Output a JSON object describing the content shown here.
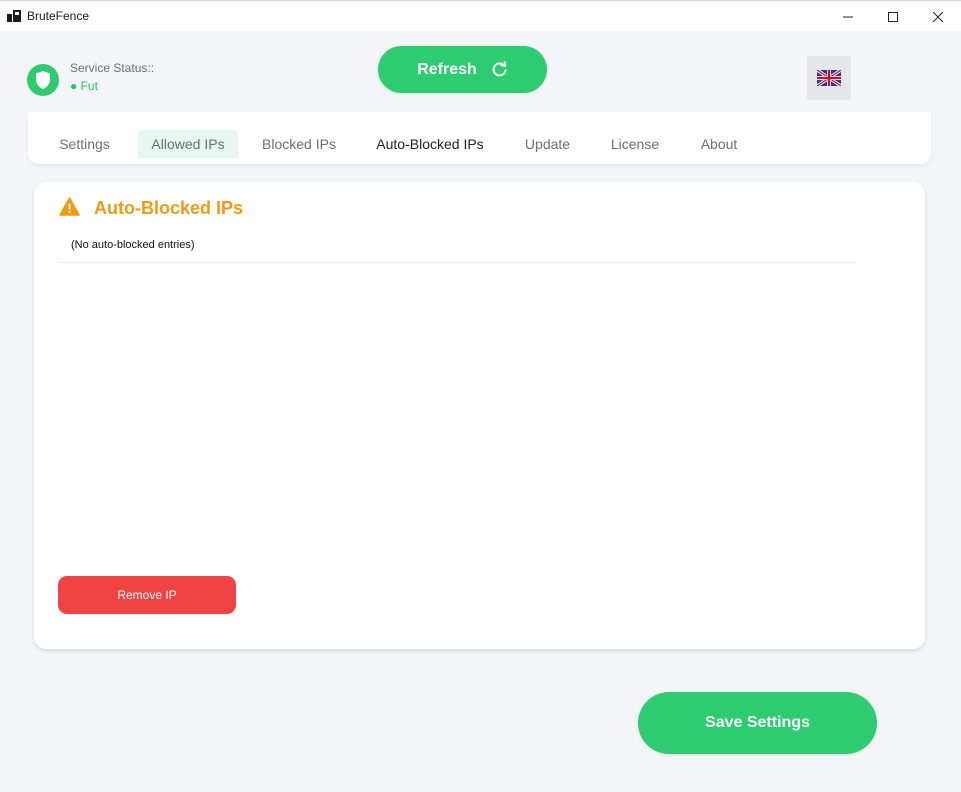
{
  "window": {
    "title": "BruteFence"
  },
  "header": {
    "status_label": "Service Status::",
    "status_value": "● Fut",
    "refresh_label": "Refresh",
    "language_flag": "uk-flag-icon"
  },
  "tabs": [
    {
      "label": "Settings"
    },
    {
      "label": "Allowed IPs"
    },
    {
      "label": "Blocked IPs"
    },
    {
      "label": "Auto-Blocked IPs"
    },
    {
      "label": "Update"
    },
    {
      "label": "License"
    },
    {
      "label": "About"
    }
  ],
  "panel": {
    "title": "Auto-Blocked IPs",
    "empty_text": "(No auto-blocked entries)",
    "remove_label": "Remove IP"
  },
  "footer": {
    "save_label": "Save Settings"
  },
  "colors": {
    "accent_green": "#2ecc71",
    "warning_orange": "#ef9a12",
    "danger_red": "#f04444"
  }
}
